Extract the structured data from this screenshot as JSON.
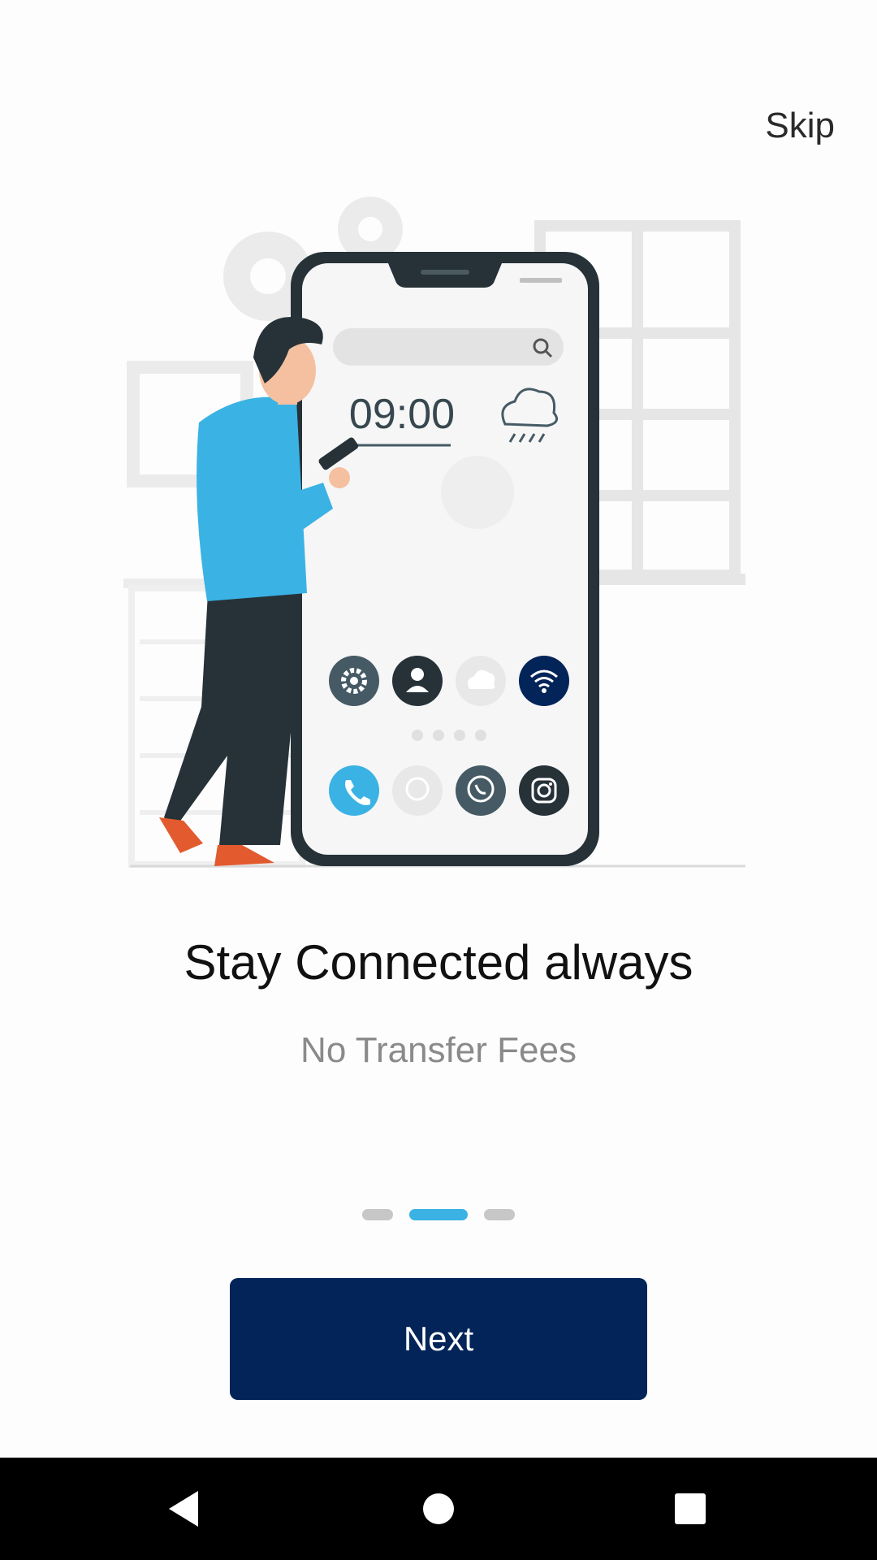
{
  "header": {
    "skip_label": "Skip"
  },
  "illustration": {
    "clock_time": "09:00"
  },
  "onboarding": {
    "title": "Stay Connected always",
    "subtitle": "No Transfer Fees",
    "page_total": 3,
    "page_current": 2
  },
  "actions": {
    "next_label": "Next"
  },
  "colors": {
    "accent": "#3ab2e4",
    "primary": "#022459",
    "dot_inactive": "#c7c7c7",
    "text_dark": "#111111",
    "text_muted": "#8a8a8a"
  },
  "navbar": {
    "icons": [
      "back-icon",
      "home-icon",
      "recents-icon"
    ]
  }
}
